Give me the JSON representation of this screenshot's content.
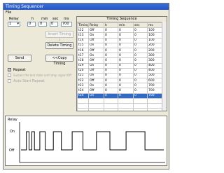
{
  "window": {
    "title": "Timing Sequencer"
  },
  "menu": {
    "file": "File"
  },
  "controls": {
    "headers": {
      "relay": "Relay",
      "h": "h",
      "min": "min",
      "sec": "sec",
      "ms": "ms"
    },
    "values": {
      "relay": "1",
      "h": "0",
      "min": "0",
      "sec": "0",
      "ms": "700"
    },
    "buttons": {
      "insert_timing": "Insert Timing ↓",
      "delete_timing": "Delete Timing",
      "send": "Send",
      "copy_timing": "<<Copy Timing"
    },
    "checks": {
      "repeat": "Repeat",
      "sustain": "Sustain the last state until stop signal Off",
      "auto_start": "Auto Start Repeat"
    }
  },
  "sequence": {
    "title": "Timing Sequence",
    "columns": [
      "Timing",
      "Relay",
      "h",
      "min",
      "sec",
      "ms"
    ],
    "rows": [
      [
        "t12",
        "Off",
        "0",
        "0",
        "0",
        "100"
      ],
      [
        "t13",
        "On",
        "0",
        "0",
        "0",
        "100"
      ],
      [
        "t14",
        "Off",
        "0",
        "0",
        "0",
        "100"
      ],
      [
        "t15",
        "On",
        "0",
        "0",
        "0",
        "200"
      ],
      [
        "t16",
        "Off",
        "0",
        "0",
        "0",
        "200"
      ],
      [
        "t17",
        "On",
        "0",
        "0",
        "0",
        "300"
      ],
      [
        "t18",
        "Off",
        "0",
        "0",
        "0",
        "300"
      ],
      [
        "t19",
        "On",
        "0",
        "0",
        "0",
        "400"
      ],
      [
        "t20",
        "Off",
        "0",
        "0",
        "0",
        "400"
      ],
      [
        "t21",
        "On",
        "0",
        "0",
        "0",
        "500"
      ],
      [
        "t22",
        "Off",
        "0",
        "0",
        "0",
        "600"
      ],
      [
        "t23",
        "On",
        "0",
        "0",
        "0",
        "700"
      ],
      [
        "t24",
        "Off",
        "0",
        "0",
        "0",
        "700"
      ],
      [
        "t24",
        "On",
        "0",
        "0",
        "0",
        "700"
      ],
      [
        "",
        "",
        "",
        "",
        "",
        ""
      ],
      [
        "",
        "",
        "",
        "",
        "",
        ""
      ],
      [
        "",
        "",
        "",
        "",
        "",
        ""
      ],
      [
        "",
        "",
        "",
        "",
        "",
        ""
      ]
    ]
  },
  "relay_plot": {
    "label": "Relay",
    "on_label": "On",
    "off_label": "Off",
    "states": [
      {
        "state": "Off",
        "ms": 200
      },
      {
        "state": "On",
        "ms": 100
      },
      {
        "state": "Off",
        "ms": 100
      },
      {
        "state": "On",
        "ms": 100
      },
      {
        "state": "Off",
        "ms": 200
      },
      {
        "state": "On",
        "ms": 200
      },
      {
        "state": "Off",
        "ms": 300
      },
      {
        "state": "On",
        "ms": 300
      },
      {
        "state": "Off",
        "ms": 400
      },
      {
        "state": "On",
        "ms": 400
      },
      {
        "state": "Off",
        "ms": 500
      },
      {
        "state": "On",
        "ms": 500
      },
      {
        "state": "Off",
        "ms": 600
      },
      {
        "state": "On",
        "ms": 700
      },
      {
        "state": "Off",
        "ms": 700
      }
    ]
  }
}
